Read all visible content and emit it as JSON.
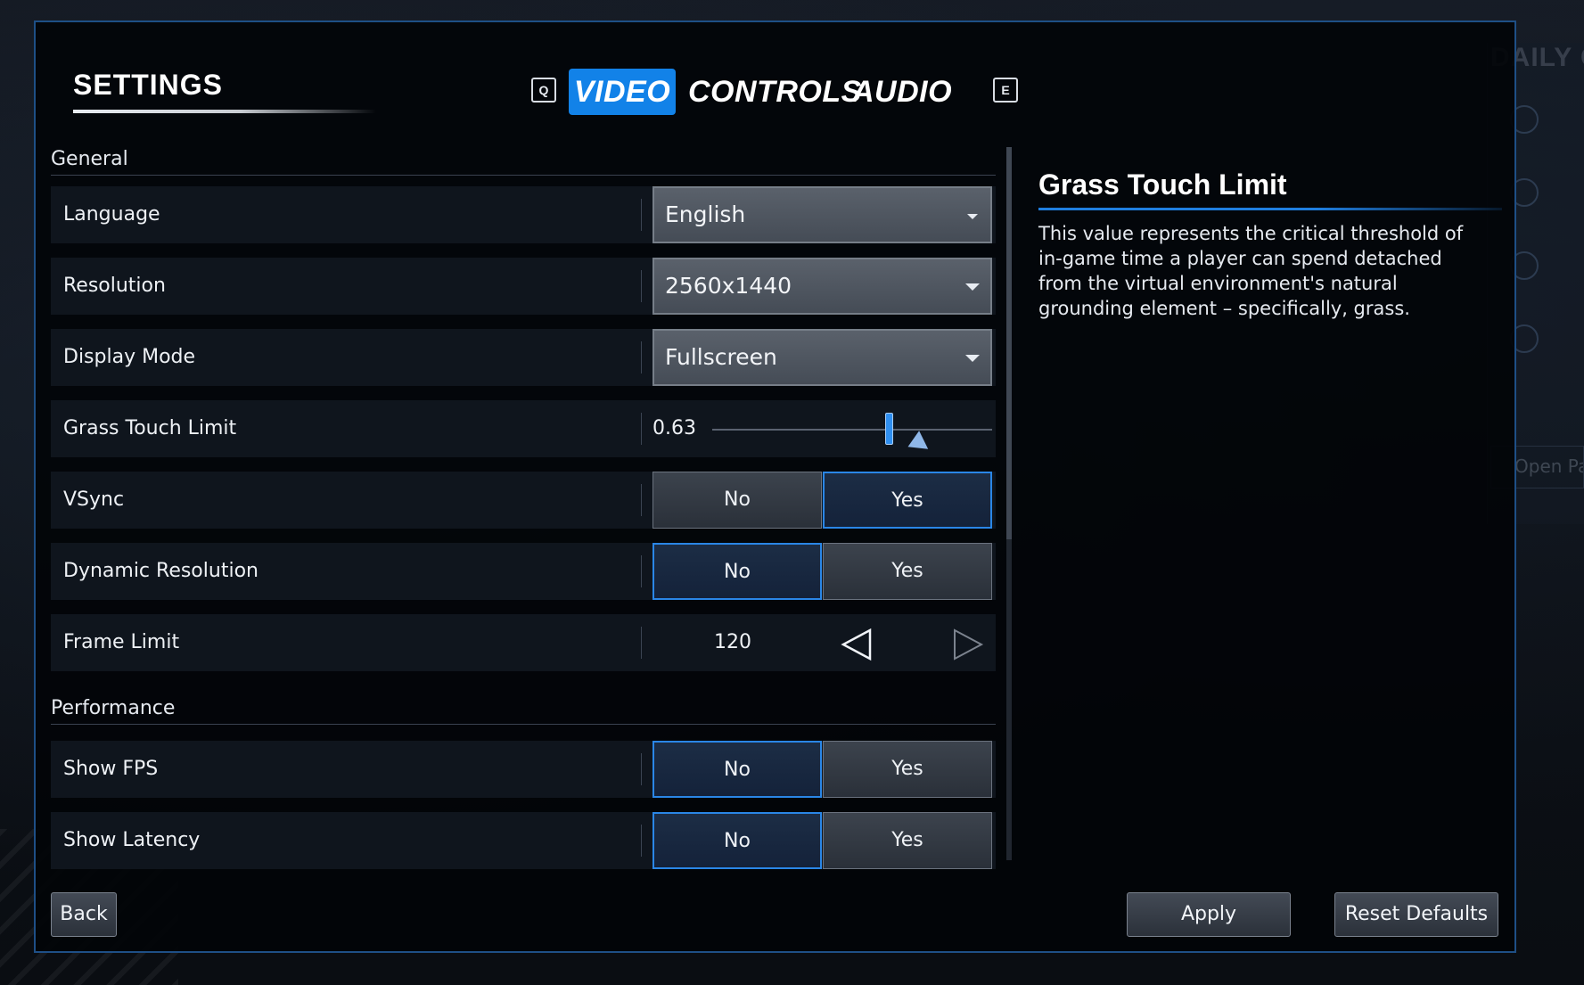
{
  "background": {
    "daily_title": "DAILY C",
    "open_button": "Open Pa"
  },
  "header": {
    "title": "SETTINGS",
    "prev_key": "Q",
    "next_key": "E",
    "tabs": [
      {
        "label": "VIDEO",
        "active": true
      },
      {
        "label": "CONTROLS",
        "active": false
      },
      {
        "label": "AUDIO",
        "active": false
      }
    ]
  },
  "sections": {
    "general": "General",
    "performance": "Performance"
  },
  "settings": {
    "language": {
      "label": "Language",
      "value": "English"
    },
    "resolution": {
      "label": "Resolution",
      "value": "2560x1440"
    },
    "display_mode": {
      "label": "Display Mode",
      "value": "Fullscreen"
    },
    "grass_touch_limit": {
      "label": "Grass Touch Limit",
      "value": "0.63",
      "level": 0.63
    },
    "vsync": {
      "label": "VSync",
      "no": "No",
      "yes": "Yes",
      "selected": "Yes"
    },
    "dynamic_resolution": {
      "label": "Dynamic Resolution",
      "no": "No",
      "yes": "Yes",
      "selected": "No"
    },
    "frame_limit": {
      "label": "Frame Limit",
      "value": "120"
    },
    "show_fps": {
      "label": "Show FPS",
      "no": "No",
      "yes": "Yes",
      "selected": "No"
    },
    "show_latency": {
      "label": "Show Latency",
      "no": "No",
      "yes": "Yes",
      "selected": "No"
    }
  },
  "info": {
    "title": "Grass Touch Limit",
    "description": "This value represents the critical threshold of in-game time a player can spend detached from the virtual environment's natural grounding element – specifically, grass."
  },
  "footer": {
    "back": "Back",
    "apply": "Apply",
    "reset": "Reset Defaults"
  },
  "colors": {
    "accent": "#1282e8",
    "border": "#1e4f86",
    "selected_border": "#2a86e6"
  }
}
